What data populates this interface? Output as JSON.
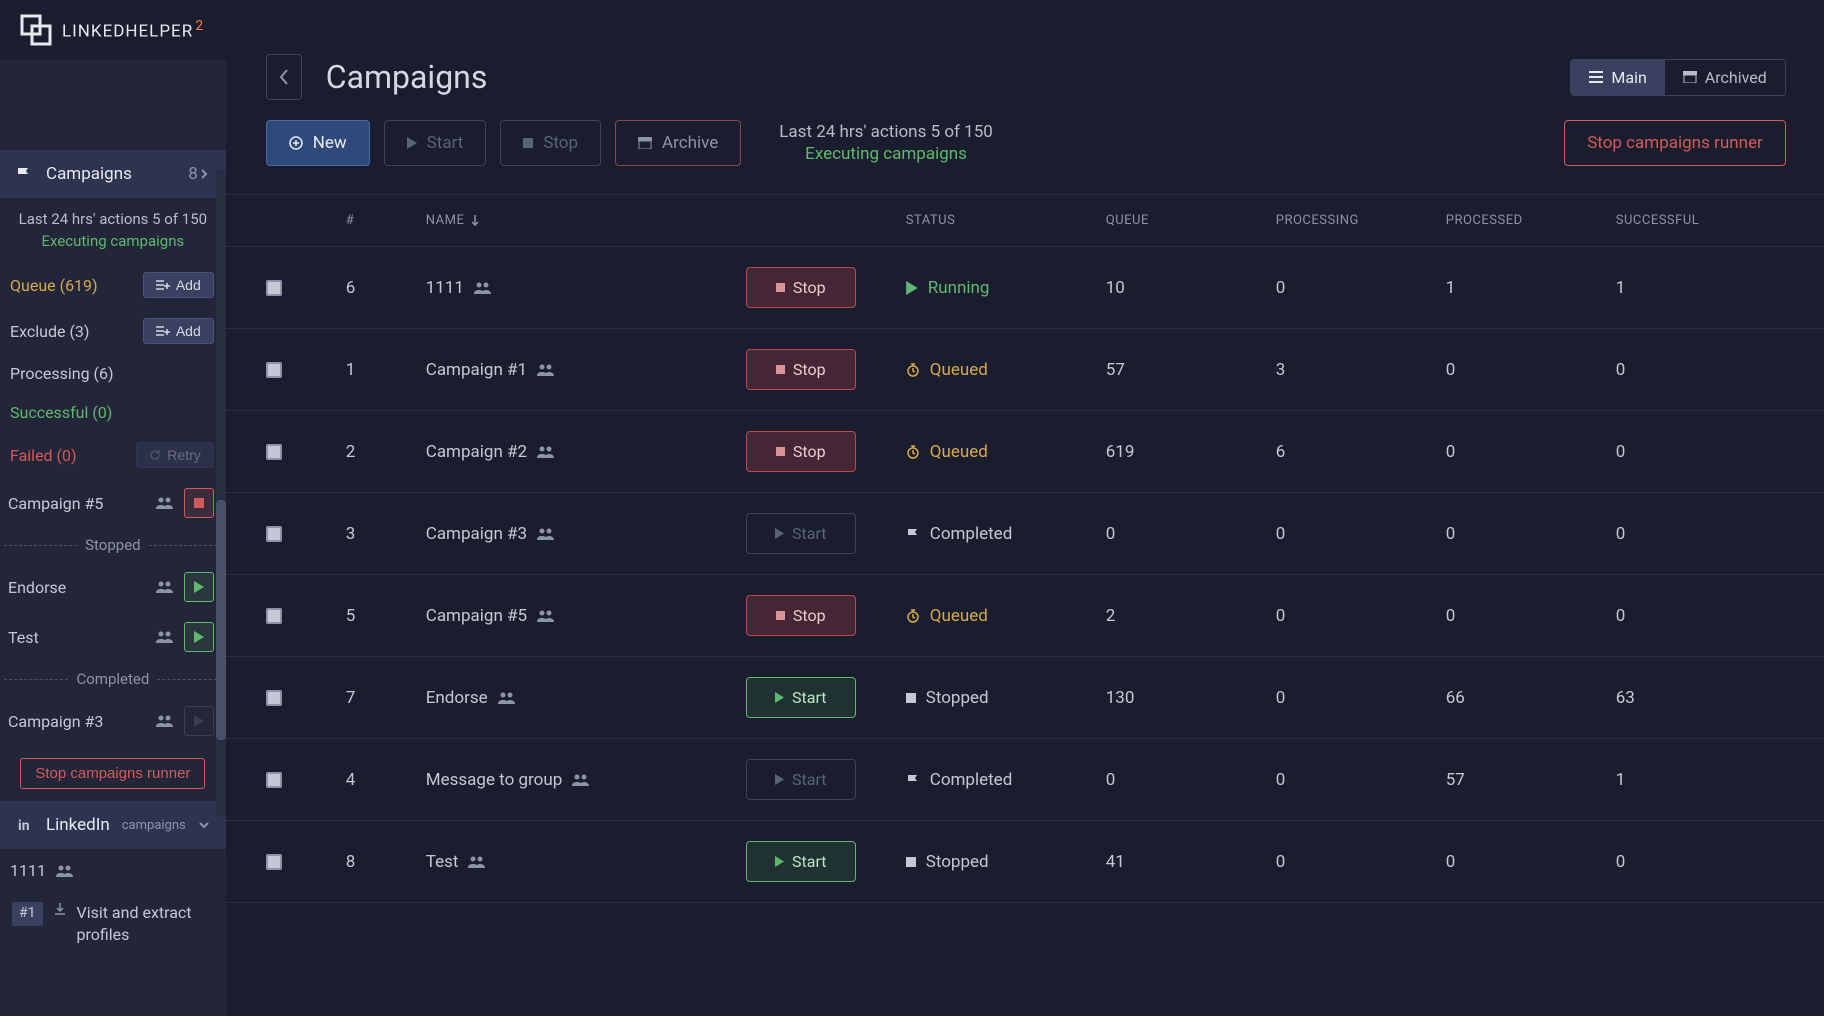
{
  "brand": {
    "name": "LINKEDHELPER",
    "sup": "2"
  },
  "sidebar": {
    "nav": {
      "label": "Campaigns",
      "count": "8"
    },
    "stats": {
      "line1": "Last 24 hrs' actions 5 of 150",
      "line2": "Executing campaigns"
    },
    "queue": {
      "label": "Queue (619)",
      "add": "Add"
    },
    "exclude": {
      "label": "Exclude (3)",
      "add": "Add"
    },
    "processing": {
      "label": "Processing (6)"
    },
    "successful": {
      "label": "Successful (0)"
    },
    "failed": {
      "label": "Failed (0)",
      "retry": "Retry"
    },
    "active": {
      "name": "Campaign #5"
    },
    "stopped_header": "Stopped",
    "stopped": [
      {
        "name": "Endorse"
      },
      {
        "name": "Test"
      }
    ],
    "completed_header": "Completed",
    "completed": [
      {
        "name": "Campaign #3"
      }
    ],
    "stop_runner": "Stop campaigns runner",
    "linkedin": {
      "label": "LinkedIn",
      "sub": "campaigns"
    },
    "account": {
      "name": "1111"
    },
    "task": {
      "num": "#1",
      "text": "Visit and extract profiles"
    }
  },
  "header": {
    "title": "Campaigns",
    "tab_main": "Main",
    "tab_archived": "Archived"
  },
  "toolbar": {
    "new": "New",
    "start": "Start",
    "stop": "Stop",
    "archive": "Archive",
    "stats_line1": "Last 24 hrs' actions 5 of 150",
    "stats_line2": "Executing campaigns",
    "stop_runner": "Stop campaigns runner"
  },
  "table": {
    "headers": {
      "num": "#",
      "name": "NAME",
      "status": "STATUS",
      "queue": "QUEUE",
      "processing": "PROCESSING",
      "processed": "PROCESSED",
      "successful": "SUCCESSFUL"
    },
    "rows": [
      {
        "num": "6",
        "name": "1111",
        "btn": "Stop",
        "btn_type": "stop",
        "status": "Running",
        "status_type": "running",
        "queue": "10",
        "processing": "0",
        "processed": "1",
        "successful": "1"
      },
      {
        "num": "1",
        "name": "Campaign #1",
        "btn": "Stop",
        "btn_type": "stop",
        "status": "Queued",
        "status_type": "queued",
        "queue": "57",
        "processing": "3",
        "processed": "0",
        "successful": "0"
      },
      {
        "num": "2",
        "name": "Campaign #2",
        "btn": "Stop",
        "btn_type": "stop",
        "status": "Queued",
        "status_type": "queued",
        "queue": "619",
        "processing": "6",
        "processed": "0",
        "successful": "0"
      },
      {
        "num": "3",
        "name": "Campaign #3",
        "btn": "Start",
        "btn_type": "start-dim",
        "status": "Completed",
        "status_type": "completed",
        "queue": "0",
        "processing": "0",
        "processed": "0",
        "successful": "0"
      },
      {
        "num": "5",
        "name": "Campaign #5",
        "btn": "Stop",
        "btn_type": "stop",
        "status": "Queued",
        "status_type": "queued",
        "queue": "2",
        "processing": "0",
        "processed": "0",
        "successful": "0"
      },
      {
        "num": "7",
        "name": "Endorse",
        "btn": "Start",
        "btn_type": "start",
        "status": "Stopped",
        "status_type": "stopped",
        "queue": "130",
        "processing": "0",
        "processed": "66",
        "successful": "63"
      },
      {
        "num": "4",
        "name": "Message to group",
        "btn": "Start",
        "btn_type": "start-dim",
        "status": "Completed",
        "status_type": "completed",
        "queue": "0",
        "processing": "0",
        "processed": "57",
        "successful": "1"
      },
      {
        "num": "8",
        "name": "Test",
        "btn": "Start",
        "btn_type": "start",
        "status": "Stopped",
        "status_type": "stopped",
        "queue": "41",
        "processing": "0",
        "processed": "0",
        "successful": "0"
      }
    ]
  }
}
